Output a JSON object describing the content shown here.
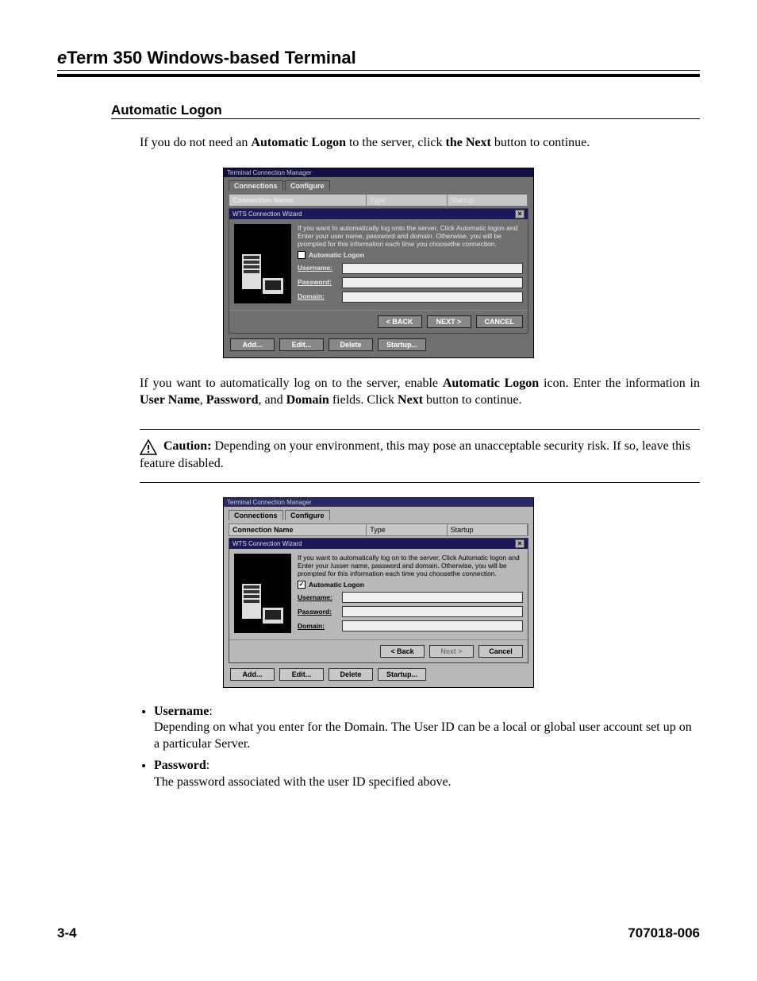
{
  "header": {
    "prefix": "e",
    "title_rest": "Term 350 Windows-based Terminal"
  },
  "section_heading": "Automatic Logon",
  "para1_pre": "If you do not need an ",
  "para1_b1": "Automatic Logon",
  "para1_mid": " to the server, click ",
  "para1_b2": "the Next",
  "para1_post": " button to continue.",
  "para2_pre": "If you want to automatically log on to the server, enable ",
  "para2_b1": "Automatic Logon",
  "para2_mid1": " icon. Enter the information in ",
  "para2_b2": "User Name",
  "para2_c1": ", ",
  "para2_b3": "Password",
  "para2_c2": ", and ",
  "para2_b4": "Domain",
  "para2_mid2": " fields. Click ",
  "para2_b5": "Next",
  "para2_post": " button to continue.",
  "caution_label": "Caution:",
  "caution_text": " Depending on your environment, this may pose an unacceptable security risk. If so, leave this feature disabled.",
  "list": {
    "username_label": "Username",
    "username_text": "Depending on what you enter for the Domain. The User ID can be a local or global user account set up on a particular Server.",
    "password_label": "Password",
    "password_text": "The password associated with the user ID specified above."
  },
  "screenshot1": {
    "window_title": "Terminal Connection Manager",
    "tabs": [
      "Connections",
      "Configure"
    ],
    "col_conn": "Connection Name",
    "col_type": "Type",
    "col_startup": "Startup",
    "wizard_title": "WTS Connection Wizard",
    "instruct": "If you want to automatically log onto the server, Click Automatic logon and Enter your user name, password and domain. Otherwise, you will be prompted for this information each time you choosethe connection.",
    "checkbox_label": "Automatic Logon",
    "checked": false,
    "username_label": "Username:",
    "password_label": "Password:",
    "domain_label": "Domain:",
    "back": "< BACK",
    "next": "NEXT >",
    "cancel": "CANCEL",
    "bottom": {
      "add": "Add...",
      "edit": "Edit...",
      "delete": "Delete",
      "startup": "Startup..."
    }
  },
  "screenshot2": {
    "window_title": "Terminal Connection Manager",
    "tabs": [
      "Connections",
      "Configure"
    ],
    "col_conn": "Connection Name",
    "col_type": "Type",
    "col_startup": "Startup",
    "wizard_title": "WTS Connection Wizard",
    "instruct": "If you want to automatically log on to the server, Click Automatic logon and Enter your /usser name, password and domain. Otherwise, you will be prompted for this information each time you choosethe connection.",
    "checkbox_label": "Automatic Logon",
    "checked": true,
    "username_label": "Username:",
    "password_label": "Password:",
    "domain_label": "Domain:",
    "back": "< Back",
    "next": "Next >",
    "cancel": "Cancel",
    "bottom": {
      "add": "Add...",
      "edit": "Edit...",
      "delete": "Delete",
      "startup": "Startup..."
    }
  },
  "footer": {
    "page": "3-4",
    "docnum": "707018-006"
  }
}
